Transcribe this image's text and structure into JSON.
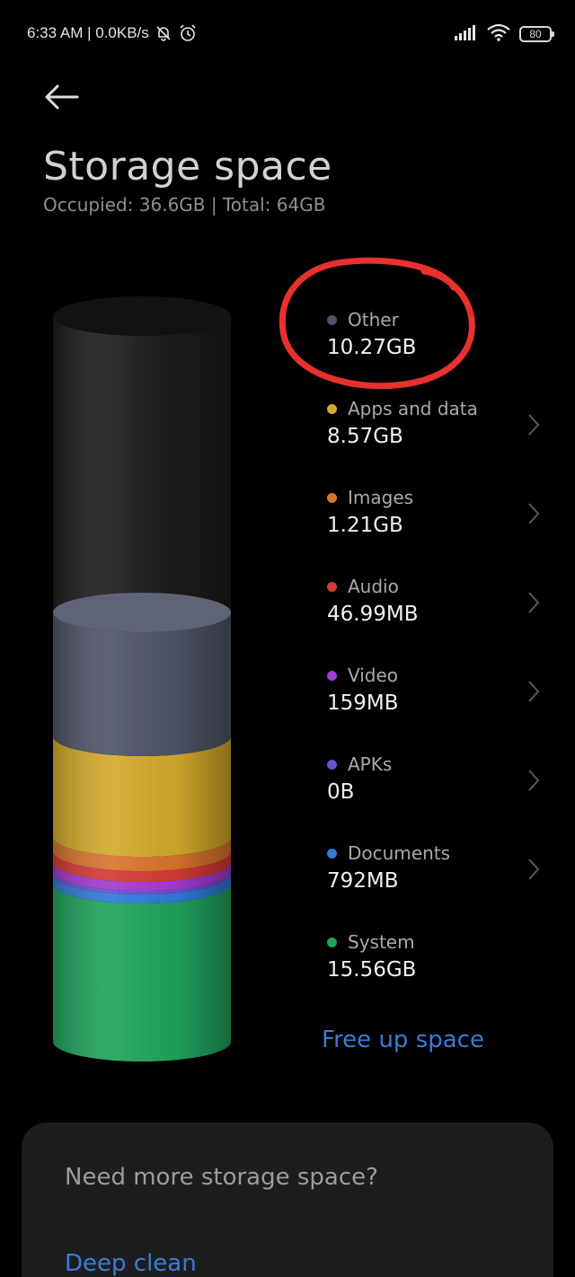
{
  "status_bar": {
    "time_speed": "6:33 AM | 0.0KB/s",
    "battery": "80"
  },
  "header": {
    "title": "Storage space",
    "subtitle": "Occupied: 36.6GB | Total: 64GB"
  },
  "colors": {
    "other": "#4f5466",
    "apps": "#d3aa2a",
    "images": "#d9742d",
    "audio": "#d63a34",
    "video": "#a23bd3",
    "apks": "#6a4fd0",
    "documents": "#2e7bd9",
    "system": "#1fa35c",
    "accent": "#3a7bd5",
    "highlight": "#e8312e"
  },
  "legend": [
    {
      "key": "other",
      "label": "Other",
      "value": "10.27GB",
      "has_chevron": false
    },
    {
      "key": "apps",
      "label": "Apps and data",
      "value": "8.57GB",
      "has_chevron": true
    },
    {
      "key": "images",
      "label": "Images",
      "value": "1.21GB",
      "has_chevron": true
    },
    {
      "key": "audio",
      "label": "Audio",
      "value": "46.99MB",
      "has_chevron": true
    },
    {
      "key": "video",
      "label": "Video",
      "value": "159MB",
      "has_chevron": true
    },
    {
      "key": "apks",
      "label": "APKs",
      "value": "0B",
      "has_chevron": true
    },
    {
      "key": "documents",
      "label": "Documents",
      "value": "792MB",
      "has_chevron": true
    },
    {
      "key": "system",
      "label": "System",
      "value": "15.56GB",
      "has_chevron": false
    }
  ],
  "actions": {
    "free_up": "Free up space"
  },
  "promo": {
    "title": "Need more storage space?",
    "link": "Deep clean"
  }
}
